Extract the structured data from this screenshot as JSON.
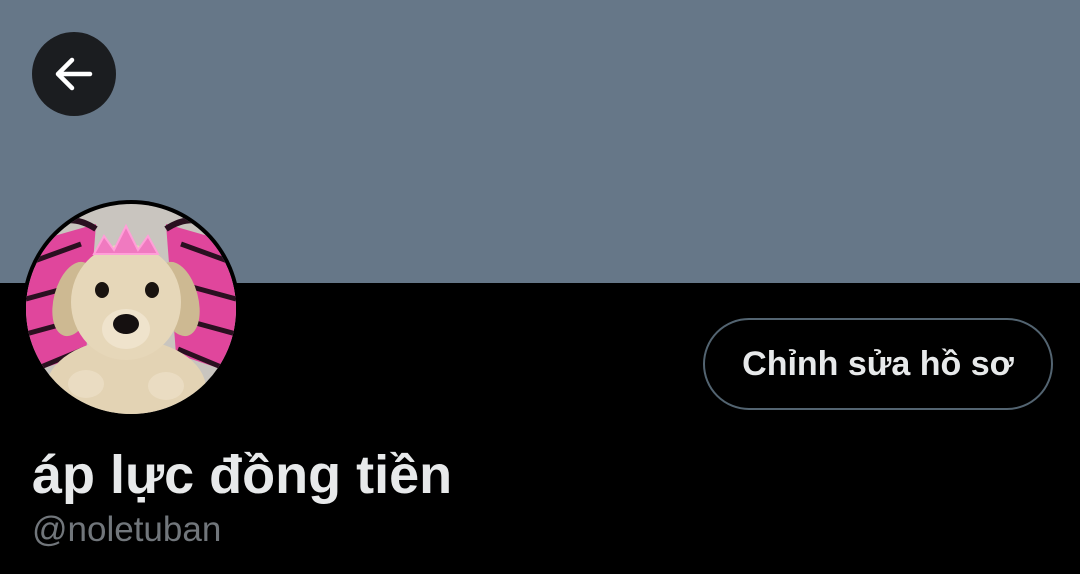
{
  "profile": {
    "display_name": "áp lực đồng tiền",
    "handle": "@noletuban",
    "edit_button_label": "Chỉnh sửa hồ sơ"
  },
  "icons": {
    "back": "arrow-left-icon",
    "avatar": "puppy-with-pink-tiara-photo"
  },
  "colors": {
    "banner": "#667788",
    "background": "#000000",
    "primary_text": "#e7e9ea",
    "secondary_text": "#71767b",
    "button_border": "#536471"
  }
}
